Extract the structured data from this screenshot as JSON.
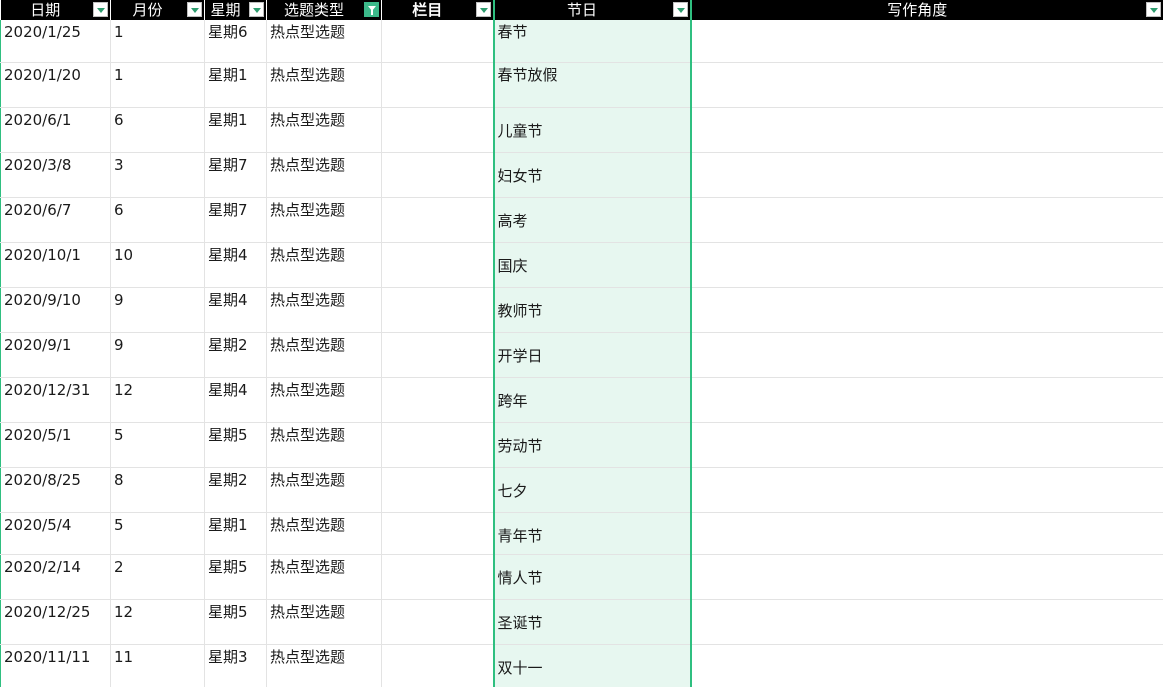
{
  "headers": {
    "date": "日期",
    "month": "月份",
    "weekday": "星期",
    "type": "选题类型",
    "column": "栏目",
    "holiday": "节日",
    "angle": "写作角度"
  },
  "rows": [
    {
      "date": "2020/1/25",
      "month": "1",
      "weekday": "星期6",
      "type": "热点型选题",
      "column": "",
      "holiday": "春节",
      "angle": ""
    },
    {
      "date": "2020/1/20",
      "month": "1",
      "weekday": "星期1",
      "type": "热点型选题",
      "column": "",
      "holiday": "春节放假",
      "angle": ""
    },
    {
      "date": "2020/6/1",
      "month": "6",
      "weekday": "星期1",
      "type": "热点型选题",
      "column": "",
      "holiday": "儿童节",
      "angle": ""
    },
    {
      "date": "2020/3/8",
      "month": "3",
      "weekday": "星期7",
      "type": "热点型选题",
      "column": "",
      "holiday": "妇女节",
      "angle": ""
    },
    {
      "date": "2020/6/7",
      "month": "6",
      "weekday": "星期7",
      "type": "热点型选题",
      "column": "",
      "holiday": "高考",
      "angle": ""
    },
    {
      "date": "2020/10/1",
      "month": "10",
      "weekday": "星期4",
      "type": "热点型选题",
      "column": "",
      "holiday": "国庆",
      "angle": ""
    },
    {
      "date": "2020/9/10",
      "month": "9",
      "weekday": "星期4",
      "type": "热点型选题",
      "column": "",
      "holiday": "教师节",
      "angle": ""
    },
    {
      "date": "2020/9/1",
      "month": "9",
      "weekday": "星期2",
      "type": "热点型选题",
      "column": "",
      "holiday": "开学日",
      "angle": ""
    },
    {
      "date": "2020/12/31",
      "month": "12",
      "weekday": "星期4",
      "type": "热点型选题",
      "column": "",
      "holiday": "跨年",
      "angle": ""
    },
    {
      "date": "2020/5/1",
      "month": "5",
      "weekday": "星期5",
      "type": "热点型选题",
      "column": "",
      "holiday": "劳动节",
      "angle": ""
    },
    {
      "date": "2020/8/25",
      "month": "8",
      "weekday": "星期2",
      "type": "热点型选题",
      "column": "",
      "holiday": "七夕",
      "angle": ""
    },
    {
      "date": "2020/5/4",
      "month": "5",
      "weekday": "星期1",
      "type": "热点型选题",
      "column": "",
      "holiday": "青年节",
      "angle": ""
    },
    {
      "date": "2020/2/14",
      "month": "2",
      "weekday": "星期5",
      "type": "热点型选题",
      "column": "",
      "holiday": "情人节",
      "angle": ""
    },
    {
      "date": "2020/12/25",
      "month": "12",
      "weekday": "星期5",
      "type": "热点型选题",
      "column": "",
      "holiday": "圣诞节",
      "angle": ""
    },
    {
      "date": "2020/11/11",
      "month": "11",
      "weekday": "星期3",
      "type": "热点型选题",
      "column": "",
      "holiday": "双十一",
      "angle": ""
    }
  ],
  "colors": {
    "header_bg": "#000000",
    "header_text": "#ffffff",
    "holiday_fill": "#e7f7f0",
    "holiday_border": "#2fbf80",
    "filter_active": "#3cb98a"
  },
  "icons": {
    "dropdown": "chevron-down-icon",
    "active_filter": "filter-icon"
  }
}
